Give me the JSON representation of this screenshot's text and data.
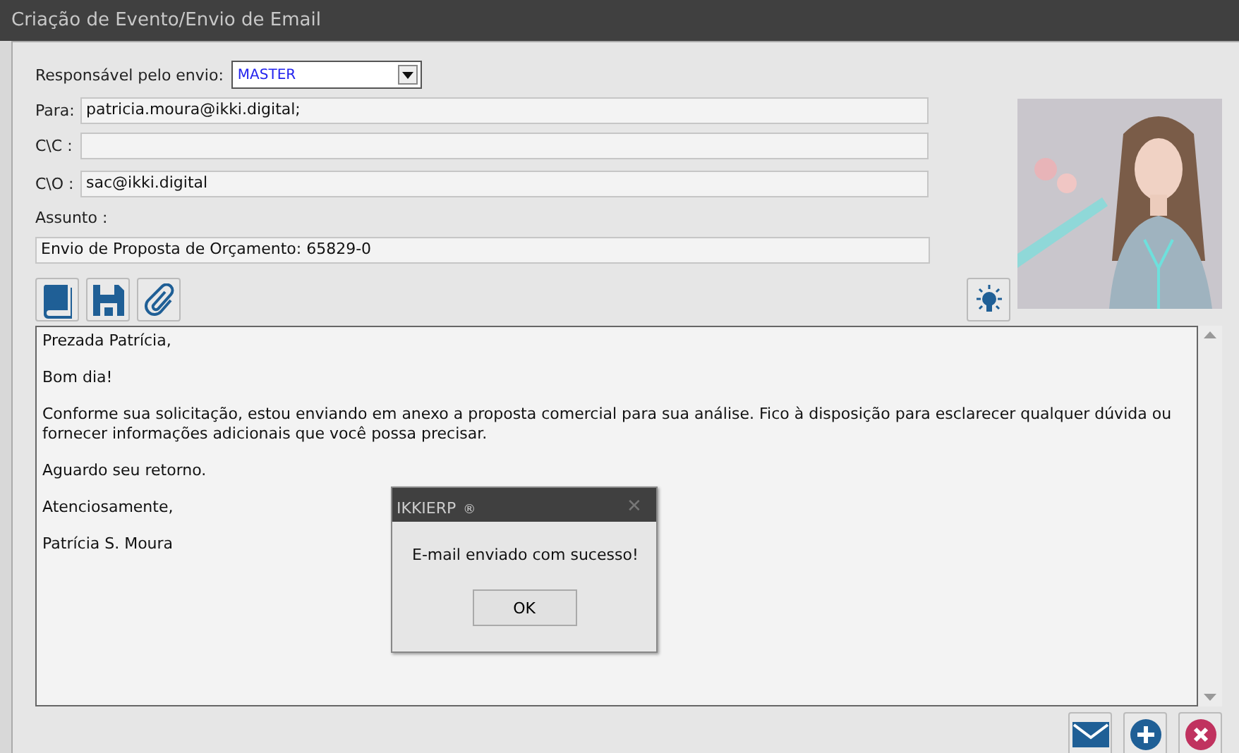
{
  "window": {
    "title": "Criação de Evento/Envio de Email"
  },
  "sender": {
    "label": "Responsável pelo envio:",
    "value": "MASTER"
  },
  "fields": [
    {
      "label": "Para:",
      "value": "patricia.moura@ikki.digital;"
    },
    {
      "label": "C\\C :"
    },
    {
      "label": "C\\O :",
      "value": "sac@ikki.digital"
    }
  ],
  "subject": {
    "label": "Assunto :",
    "value": "Envio de Proposta de Orçamento: 65829-0"
  },
  "toolbar": [
    {
      "kind": "book"
    },
    {
      "kind": "save"
    },
    {
      "kind": "attach"
    }
  ],
  "body": [
    "Prezada Patrícia,",
    "Bom dia!",
    "Conforme sua solicitação, estou enviando em anexo a proposta comercial para sua análise. Fico à disposição para esclarecer qualquer dúvida ou fornecer informações adicionais que você possa precisar.",
    "Aguardo seu retorno.",
    "Atenciosamente,",
    "Patrícia S. Moura"
  ],
  "actions": [
    {
      "kind": "send"
    },
    {
      "kind": "add"
    },
    {
      "kind": "cancel"
    }
  ],
  "dialog": {
    "title": "IKKIERP",
    "title_mark": "®",
    "close": "✕",
    "message": "E-mail enviado com sucesso!",
    "button": "OK"
  }
}
